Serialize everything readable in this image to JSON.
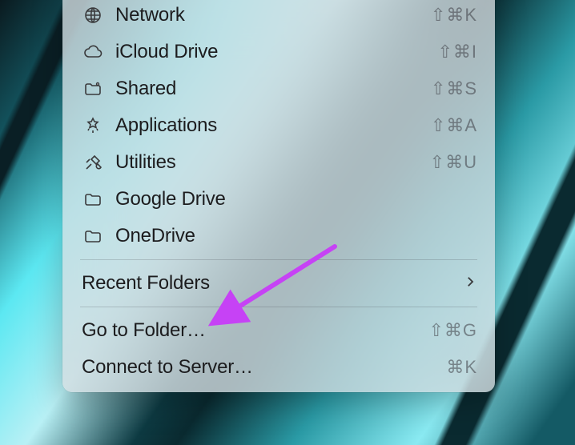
{
  "menu": {
    "section1": [
      {
        "id": "network",
        "icon": "globe",
        "label": "Network",
        "shortcut": "⇧⌘K"
      },
      {
        "id": "icloud",
        "icon": "cloud",
        "label": "iCloud Drive",
        "shortcut": "⇧⌘I"
      },
      {
        "id": "shared",
        "icon": "shared-folder",
        "label": "Shared",
        "shortcut": "⇧⌘S"
      },
      {
        "id": "applications",
        "icon": "apps",
        "label": "Applications",
        "shortcut": "⇧⌘A"
      },
      {
        "id": "utilities",
        "icon": "utilities",
        "label": "Utilities",
        "shortcut": "⇧⌘U"
      },
      {
        "id": "gdrive",
        "icon": "folder",
        "label": "Google Drive",
        "shortcut": ""
      },
      {
        "id": "onedrive",
        "icon": "folder",
        "label": "OneDrive",
        "shortcut": ""
      }
    ],
    "section2": [
      {
        "id": "recent",
        "label": "Recent Folders",
        "submenu": true
      }
    ],
    "section3": [
      {
        "id": "goto",
        "label": "Go to Folder…",
        "shortcut": "⇧⌘G"
      },
      {
        "id": "connect",
        "label": "Connect to Server…",
        "shortcut": "⌘K"
      }
    ]
  },
  "annotation": {
    "arrow_color": "#c642f5",
    "points_to": "goto"
  }
}
